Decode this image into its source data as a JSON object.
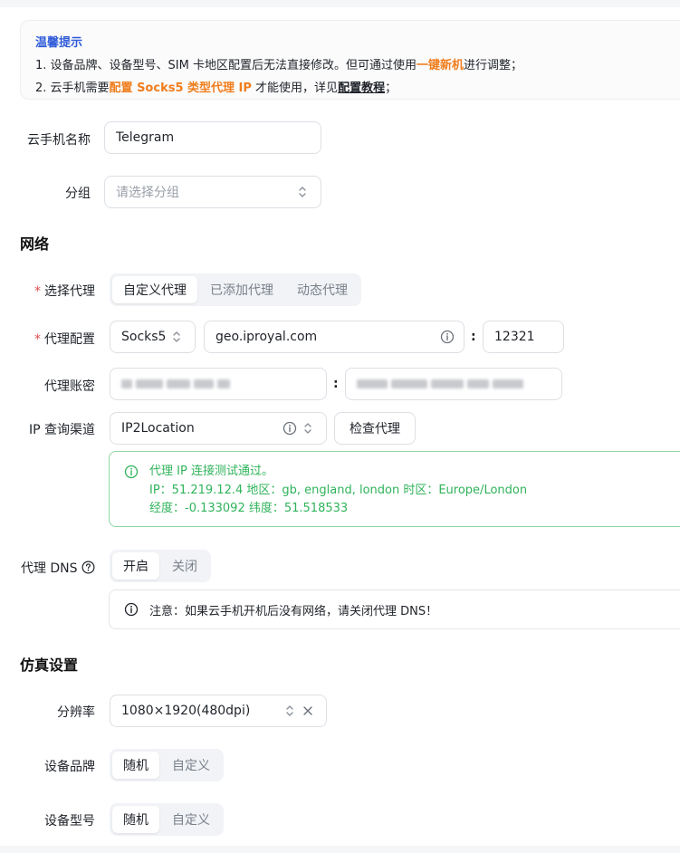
{
  "notice": {
    "title": "温馨提示",
    "line1_prefix": "1. 设备品牌、设备型号、SIM 卡地区配置后无法直接修改。但可通过使用",
    "line1_link": "一键新机",
    "line1_suffix": "进行调整；",
    "line2_prefix": "2. 云手机需要",
    "line2_highlight": "配置 Socks5 类型代理 IP",
    "line2_mid": " 才能使用，详见",
    "line2_link": "配置教程",
    "line2_suffix": "；"
  },
  "form": {
    "name_label": "云手机名称",
    "name_value": "Telegram",
    "group_label": "分组",
    "group_placeholder": "请选择分组"
  },
  "network": {
    "section_title": "网络",
    "select_proxy_label": "选择代理",
    "proxy_tabs": [
      "自定义代理",
      "已添加代理",
      "动态代理"
    ],
    "proxy_config_label": "代理配置",
    "proxy_type": "Socks5",
    "proxy_host": "geo.iproyal.com",
    "proxy_port": "12321",
    "colon": ":",
    "account_label": "代理账密",
    "ip_channel_label": "IP 查询渠道",
    "ip_channel_value": "IP2Location",
    "check_button": "检查代理",
    "result": {
      "title": "代理 IP 连接测试通过。",
      "line2": "IP：51.219.12.4  地区：gb, england, london  时区：Europe/London",
      "line3": "经度：-0.133092  纬度：51.518533"
    },
    "dns_label": "代理 DNS",
    "dns_tabs": [
      "开启",
      "关闭"
    ],
    "dns_note": "注意：如果云手机开机后没有网络，请关闭代理 DNS！"
  },
  "sim": {
    "section_title": "仿真设置",
    "resolution_label": "分辨率",
    "resolution_value": "1080×1920(480dpi)",
    "brand_label": "设备品牌",
    "brand_tabs": [
      "随机",
      "自定义"
    ],
    "model_label": "设备型号",
    "model_tabs": [
      "随机",
      "自定义"
    ]
  },
  "colors": {
    "accent_blue": "#2f5bd8",
    "highlight_orange": "#f07d1c",
    "success_green": "#2fb35a",
    "required_red": "#e5484d"
  }
}
